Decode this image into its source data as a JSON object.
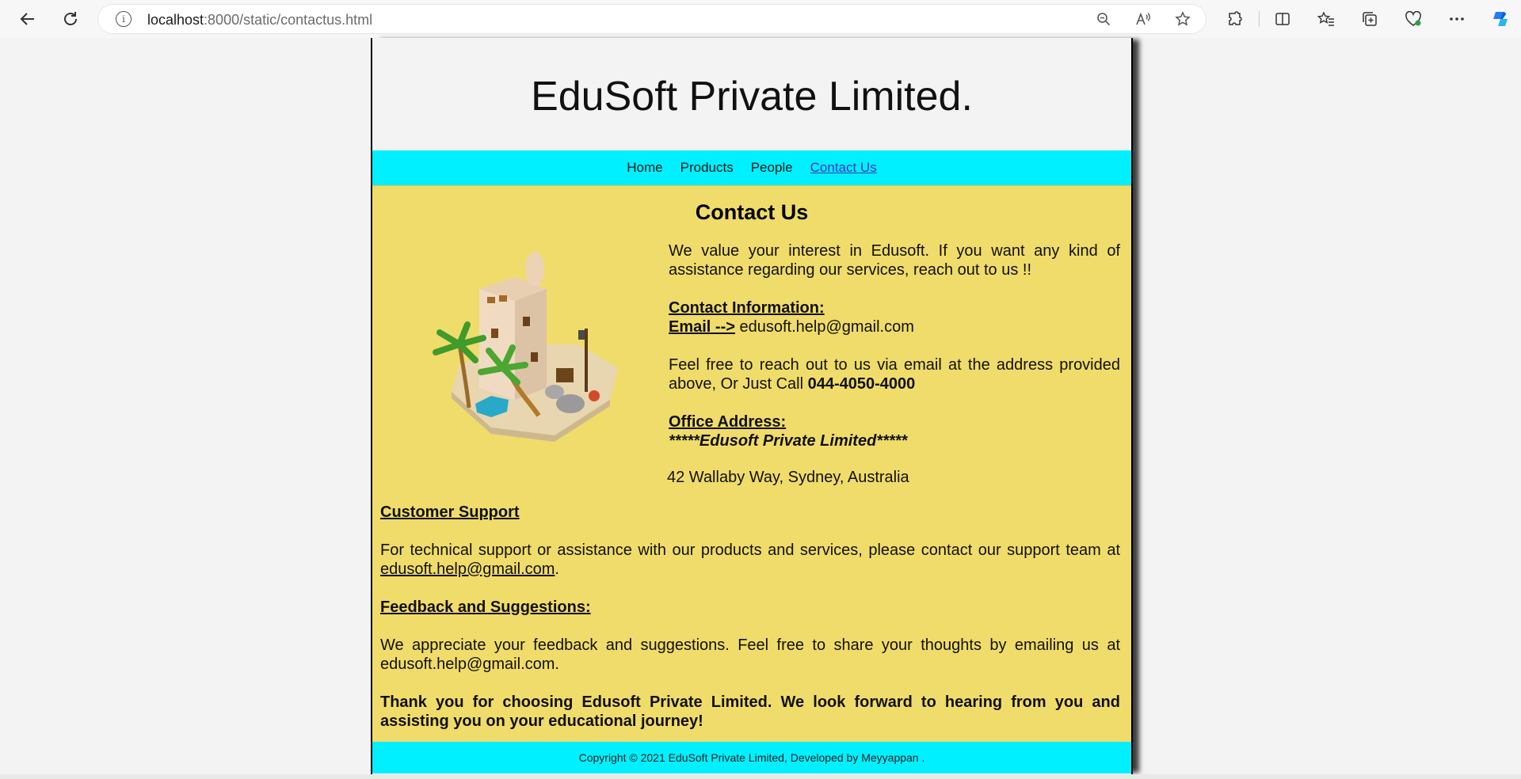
{
  "browser": {
    "url_host": "localhost",
    "url_path": ":8000/static/contactus.html",
    "info_glyph": "i"
  },
  "site": {
    "title": "EduSoft Private Limited.",
    "nav": [
      {
        "label": "Home"
      },
      {
        "label": "Products"
      },
      {
        "label": "People"
      },
      {
        "label": "Contact Us"
      }
    ]
  },
  "contact": {
    "heading": "Contact Us",
    "intro": "We value your interest in Edusoft. If you want any kind of assistance regarding our services, reach out to us !!",
    "contact_info_label": "Contact Information:",
    "email_label": "Email -->",
    "email_value": " edusoft.help@gmail.com",
    "feel_free_text": "Feel free to reach out to us via email at the address provided above, Or Just Call ",
    "phone": "044-4050-4000",
    "office_label": "Office Address:",
    "company_line": "*****Edusoft Private Limited*****",
    "street": "42 Wallaby Way, Sydney, Australia",
    "support_heading": "Customer Support",
    "support_text": "For technical support or assistance with our products and services, please contact our support team at ",
    "support_email": "edusoft.help@gmail.com",
    "support_end": ".",
    "feedback_heading": "Feedback and Suggestions:",
    "feedback_text": "We appreciate your feedback and suggestions. Feel free to share your thoughts by emailing us at edusoft.help@gmail.com.",
    "closing": "Thank you for choosing Edusoft Private Limited. We look forward to hearing from you and assisting you on your educational journey!"
  },
  "footer": {
    "copyright": "Copyright © 2021 EduSoft Private Limited, Developed by Meyyappan ."
  },
  "colors": {
    "nav_bg": "#00f0ff",
    "content_bg": "#f0dc6a",
    "active_link": "#4433cc"
  }
}
